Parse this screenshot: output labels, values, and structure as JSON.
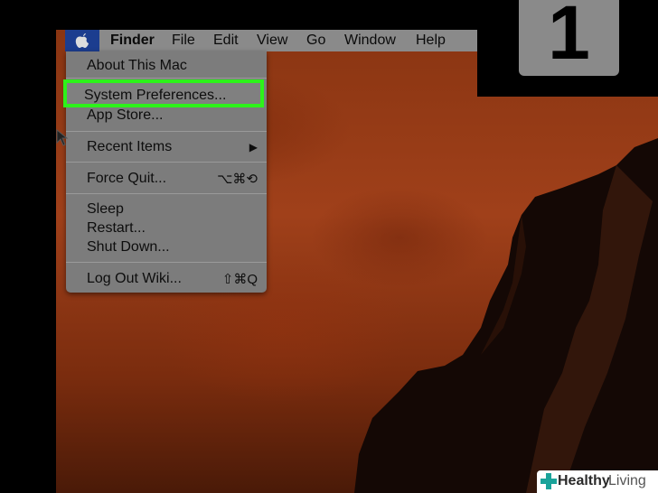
{
  "menubar": {
    "apple_icon": "apple-logo-icon",
    "items": [
      "Finder",
      "File",
      "Edit",
      "View",
      "Go",
      "Window",
      "Help"
    ]
  },
  "apple_menu": {
    "about": "About This Mac",
    "system_preferences": "System Preferences...",
    "app_store": "App Store...",
    "recent_items": "Recent Items",
    "recent_arrow": "▶",
    "force_quit": "Force Quit...",
    "force_quit_shortcut": "⌥⌘⟲",
    "sleep": "Sleep",
    "restart": "Restart...",
    "shut_down": "Shut Down...",
    "log_out": "Log Out Wiki...",
    "log_out_shortcut": "⇧⌘Q"
  },
  "step_badge": "1",
  "watermark": {
    "bold": "Healthy",
    "regular": "Living"
  },
  "colors": {
    "highlight": "#2df21a",
    "apple_selected": "#1c3d8f",
    "menu_bg": "#7c7c7c"
  }
}
